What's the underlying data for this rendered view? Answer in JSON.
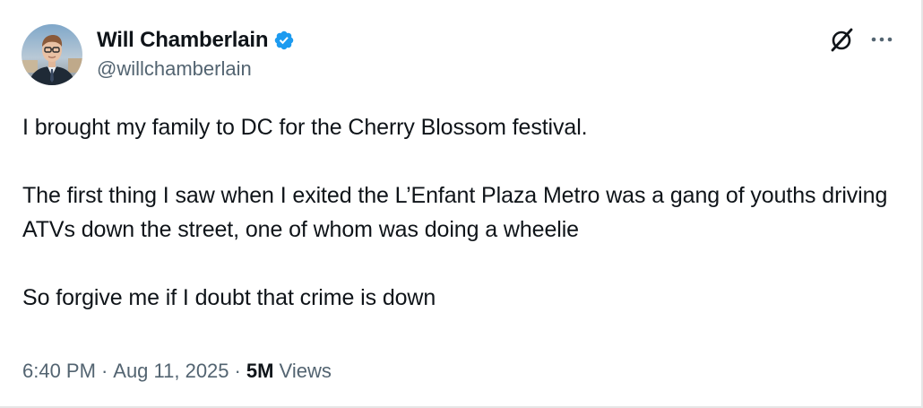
{
  "author": {
    "display_name": "Will Chamberlain",
    "handle": "@willchamberlain",
    "verified": true,
    "avatar_icon": "profile-photo",
    "verified_icon": "verified-badge-icon"
  },
  "toolbar": {
    "grok_icon": "grok-icon",
    "more_icon": "more-options-icon"
  },
  "tweet": {
    "paragraphs": [
      "I brought my family to DC for the Cherry Blossom festival.",
      "The first thing I saw when I exited the L’Enfant Plaza Metro was a gang of youths driving ATVs down the street, one of whom was doing a wheelie",
      "So forgive me if I doubt that crime is down"
    ]
  },
  "meta": {
    "time": "6:40 PM",
    "separator": "·",
    "date": "Aug 11, 2025",
    "views_count": "5M",
    "views_label": "Views"
  },
  "colors": {
    "text_primary": "#0f1419",
    "text_secondary": "#536471",
    "verified_blue": "#1d9bf0",
    "background": "#ffffff"
  }
}
